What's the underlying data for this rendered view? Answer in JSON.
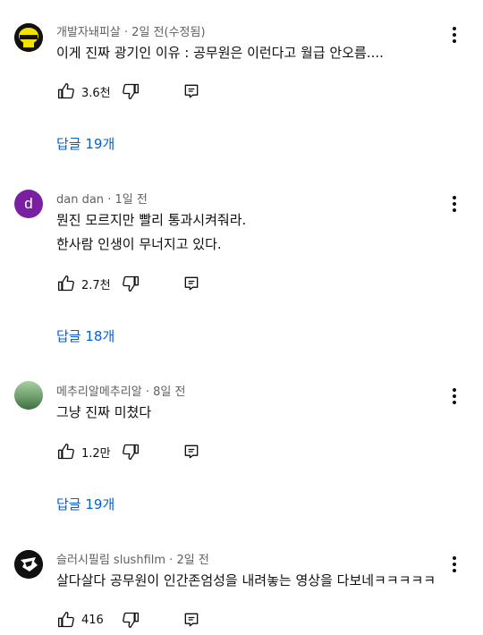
{
  "comments": [
    {
      "author": "개발자놰피살",
      "time": "2일 전(수정됨)",
      "lines": [
        "이게 진짜 광기인 이유 : 공무원은 이런다고 월급 안오름...."
      ],
      "likes": "3.6천",
      "replies": "답글 19개",
      "avatar": {
        "type": "badge",
        "bg": "#111111",
        "accent": "#f2e200",
        "text": "놰피살"
      }
    },
    {
      "author": "dan dan",
      "time": "1일 전",
      "lines": [
        "뭔진 모르지만 빨리 통과시켜줘라.",
        "한사람 인생이 무너지고 있다."
      ],
      "likes": "2.7천",
      "replies": "답글 18개",
      "avatar": {
        "type": "letter",
        "bg": "#7b1fa2",
        "text": "d"
      }
    },
    {
      "author": "메추리알메추리알",
      "time": "8일 전",
      "lines": [
        "그냥 진짜 미쳤다"
      ],
      "likes": "1.2만",
      "replies": "답글 19개",
      "avatar": {
        "type": "photo",
        "top": "#9bc49a",
        "bottom": "#3f6e45"
      }
    },
    {
      "author": "슬러시필림 slushfilm",
      "time": "2일 전",
      "lines": [
        "살다살다 공무원이 인간존엄성을 내려놓는 영상을 다보네ㅋㅋㅋㅋㅋ"
      ],
      "likes": "416",
      "avatar": {
        "type": "logo",
        "bg": "#111111"
      }
    }
  ],
  "separator": " · "
}
